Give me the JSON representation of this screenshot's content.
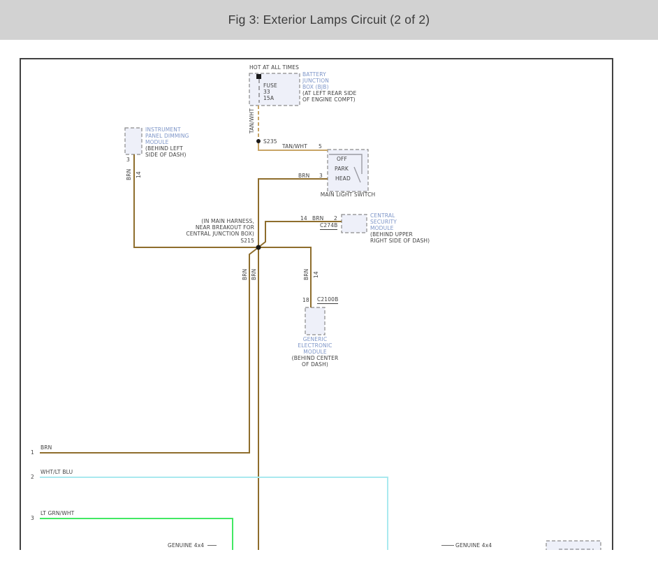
{
  "header": {
    "title": "Fig 3: Exterior Lamps Circuit (2 of 2)"
  },
  "colors": {
    "banner_bg": "#d2d2d2",
    "banner_ink": "#3b3b3b",
    "frame": "#414141",
    "ink": "#404040",
    "label_blue": "#7d95c8",
    "brn": "#8e6d2c",
    "tan": "#c8a566",
    "wht_lt_blu": "#a9e9ef",
    "lt_grn_wht": "#42e863",
    "box_fill": "#eef0f9",
    "box_border": "#8a8a8a",
    "switch_gray": "#9a9aa2"
  },
  "fuse": {
    "hot_label": "HOT AT ALL TIMES",
    "lines": [
      "FUSE",
      "33",
      "15A"
    ]
  },
  "bjb": {
    "name": [
      "BATTERY",
      "JUNCTION",
      "BOX (BJB)"
    ],
    "loc": [
      "(AT LEFT REAR SIDE",
      "OF ENGINE COMPT)"
    ]
  },
  "wires": {
    "tan_wht": "TAN/WHT",
    "brn": "BRN"
  },
  "circuits": {
    "c14": "14"
  },
  "splice235": {
    "label": "S235"
  },
  "splice215": {
    "note": [
      "(IN MAIN HARNESS,",
      "NEAR BREAKOUT FOR",
      "CENTRAL JUNCTION BOX)"
    ],
    "label": "S215"
  },
  "light_switch": {
    "pin_feed": "5",
    "pin_out": "3",
    "positions": [
      "OFF",
      "PARK",
      "HEAD"
    ],
    "name": "MAIN LIGHT SWITCH"
  },
  "dimming_module": {
    "name": [
      "INSTRUMENT",
      "PANEL DIMMING",
      "MODULE"
    ],
    "loc": [
      "(BEHIND LEFT",
      "SIDE OF DASH)"
    ],
    "pin": "3"
  },
  "security_module": {
    "pin": "2",
    "connector": "C274B",
    "name": [
      "CENTRAL",
      "SECURITY",
      "MODULE"
    ],
    "loc": [
      "(BEHIND UPPER",
      "RIGHT SIDE OF DASH)"
    ]
  },
  "gem": {
    "pin": "18",
    "connector": "C2100B",
    "name": [
      "GENERIC",
      "ELECTRONIC",
      "MODULE"
    ],
    "loc": [
      "(BEHIND CENTER",
      "OF DASH)"
    ]
  },
  "bottom_wires": [
    {
      "pin": "1",
      "label": "BRN"
    },
    {
      "pin": "2",
      "label": "WHT/LT BLU"
    },
    {
      "pin": "3",
      "label": "LT GRN/WHT"
    }
  ],
  "genuine": {
    "left": "GENUINE 4x4",
    "right": "GENUINE 4x4"
  }
}
